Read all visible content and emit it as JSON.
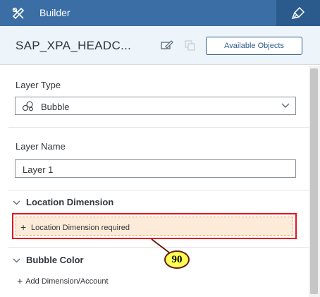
{
  "topbar": {
    "title": "Builder",
    "left_icon": "tools-icon",
    "right_icon": "paint-brush-icon"
  },
  "header": {
    "model_title": "SAP_XPA_HEADC...",
    "edit_icon": "edit-icon",
    "copy_icon": "copy-icon",
    "available_objects_label": "Available Objects"
  },
  "layer_type": {
    "label": "Layer Type",
    "value": "Bubble",
    "icon": "bubble-icon"
  },
  "layer_name": {
    "label": "Layer Name",
    "value": "Layer 1"
  },
  "location_dimension": {
    "title": "Location Dimension",
    "required_text": "Location Dimension required"
  },
  "bubble_color": {
    "title": "Bubble Color",
    "add_link": "Add Dimension/Account"
  },
  "callout": {
    "number": "90"
  },
  "colors": {
    "topbar": "#3a6ea5",
    "highlight_border": "#e8121b",
    "callout_fill": "#ffff55"
  }
}
